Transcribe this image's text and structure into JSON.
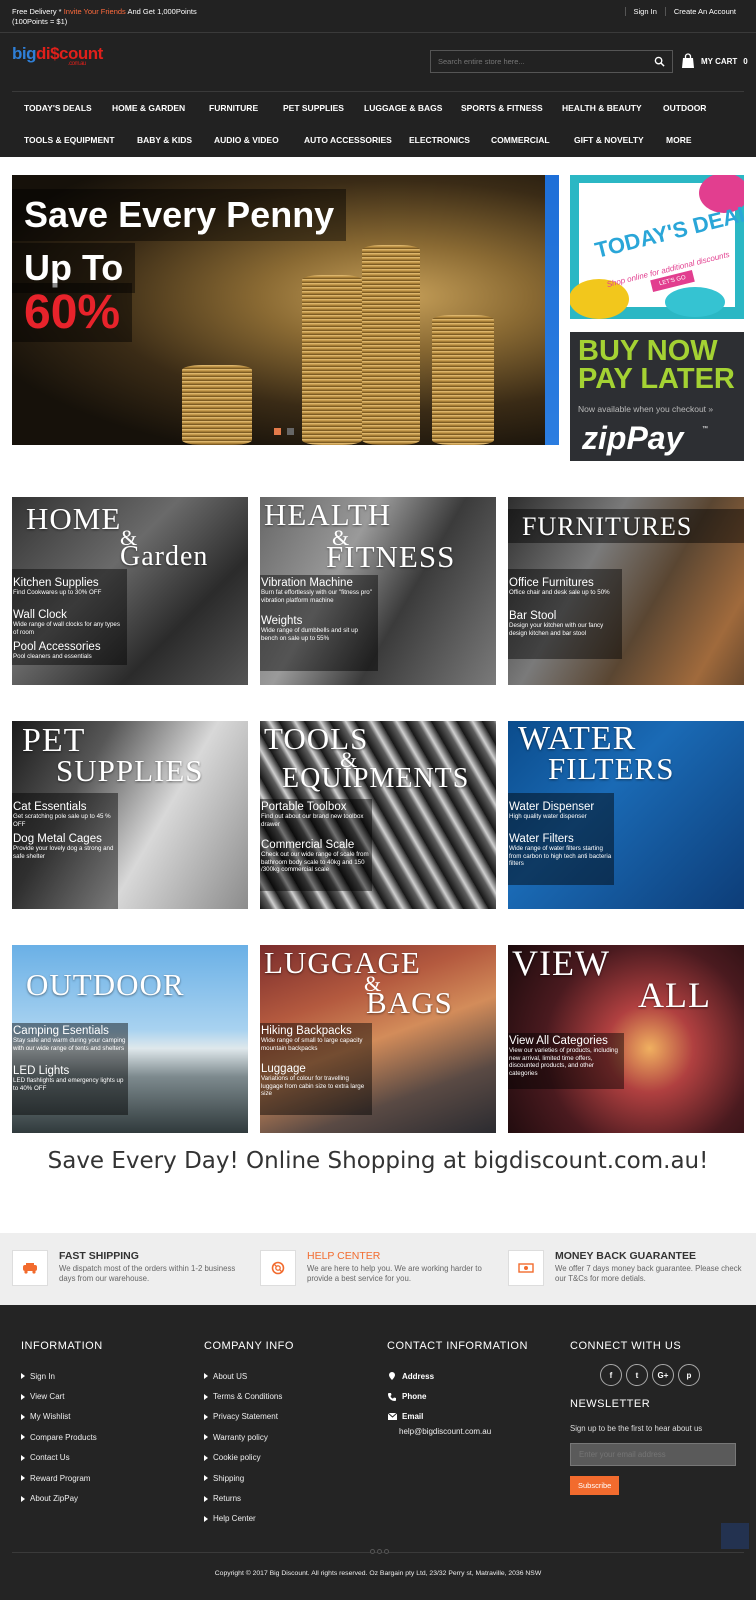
{
  "topbar": {
    "promo_prefix": "Free Delivery * ",
    "promo_link": "Invite Your Friends",
    "promo_suffix": " And Get 1,000Points",
    "promo_line2": "(100Points = $1)",
    "sign_in": "Sign In",
    "create_account": "Create An Account"
  },
  "logo": {
    "part1": "big",
    "part2": "di$count",
    "sub": ".com.au"
  },
  "search": {
    "placeholder": "Search entire store here..."
  },
  "cart": {
    "label": "MY CART",
    "count": "0"
  },
  "nav": {
    "row1": [
      "TODAY'S DEALS",
      "HOME & GARDEN",
      "FURNITURE",
      "PET SUPPLIES",
      "LUGGAGE & BAGS",
      "SPORTS & FITNESS",
      "HEALTH & BEAUTY",
      "OUTDOOR"
    ],
    "row2": [
      "TOOLS & EQUIPMENT",
      "BABY & KIDS",
      "AUDIO & VIDEO",
      "AUTO ACCESSORIES",
      "ELECTRONICS",
      "COMMERCIAL",
      "GIFT & NOVELTY",
      "MORE"
    ]
  },
  "hero": {
    "line1": "Save Every Penny",
    "line2": "Up To",
    "line3": "60%",
    "slides": 2,
    "active_slide": 1
  },
  "promo_deals": {
    "title": "TODAY'S DEALS",
    "sub": "Shop online for additional discounts",
    "button": "LET'S GO"
  },
  "promo_zip": {
    "line1": "BUY NOW",
    "line2": "PAY LATER",
    "sub": "Now available when you checkout »",
    "logo": "zipPay",
    "tm": "™"
  },
  "tiles": {
    "home": {
      "big1": "HOME",
      "amp": "&",
      "big2": "Garden",
      "items": [
        {
          "h": "Kitchen Supplies",
          "d": "Find Cookwares up to 30% OFF"
        },
        {
          "h": "Wall Clock",
          "d": "Wide range of wall clocks for any types of room"
        },
        {
          "h": "Pool Accessories",
          "d": "Pool cleaners and essentials"
        }
      ]
    },
    "health": {
      "big1": "HEALTH",
      "amp": "&",
      "big2": "FITNESS",
      "items": [
        {
          "h": "Vibration Machine",
          "d": "Burn fat effortlessly with our \"fitness pro\" vibration platform machine"
        },
        {
          "h": "Weights",
          "d": "Wide range of dumbbells and sit up bench on sale up to 55%"
        }
      ]
    },
    "furniture": {
      "big1": "FURNITURES",
      "items": [
        {
          "h": "Office Furnitures",
          "d": "Office chair and desk sale up to 50%"
        },
        {
          "h": "Bar Stool",
          "d": "Design your kitchen with our fancy design kitchen and bar stool"
        }
      ]
    },
    "pet": {
      "big1": "PET",
      "big2": "SUPPLIES",
      "items": [
        {
          "h": "Cat Essentials",
          "d": "Get scratching pole sale up to 45 % OFF"
        },
        {
          "h": "Dog Metal Cages",
          "d": "Provide your lovely dog a strong and safe shelter"
        }
      ]
    },
    "tools": {
      "big1": "TOOLS",
      "amp": "&",
      "big2": "EQUIPMENTS",
      "items": [
        {
          "h": "Portable Toolbox",
          "d": "Find out about our brand new toolbox drawer"
        },
        {
          "h": "Commercial Scale",
          "d": "Check out our wide range of scale from bathroom body scale to 40kg and 150 /300kg commercial scale"
        }
      ]
    },
    "water": {
      "big1": "WATER",
      "big2": "FILTERS",
      "items": [
        {
          "h": "Water Dispenser",
          "d": "High quality water dispenser"
        },
        {
          "h": "Water Filters",
          "d": "Wide range of water filters starting from carbon to high tech anti bacteria filters"
        }
      ]
    },
    "outdoor": {
      "big1": "OUTDOOR",
      "items": [
        {
          "h": "Camping Esentials",
          "d": "Stay safe and warm during your camping with our wide range of tents and shelters"
        },
        {
          "h": "LED Lights",
          "d": "LED flashlights and emergency lights up to 40% OFF"
        }
      ]
    },
    "luggage": {
      "big1": "LUGGAGE",
      "amp": "&",
      "big2": "BAGS",
      "items": [
        {
          "h": "Hiking Backpacks",
          "d": "Wide range of small to large capacity mountain backpacks"
        },
        {
          "h": "Luggage",
          "d": "Variations of colour for travelling luggage from cabin size to extra large size"
        }
      ]
    },
    "viewall": {
      "big1": "VIEW",
      "big2": "ALL",
      "items": [
        {
          "h": "View All Categories",
          "d": "View our varieties of products, including new arrival, limited time offers, discounted products, and other categories"
        }
      ]
    }
  },
  "tagline": "Save Every Day! Online Shopping at bigdiscount.com.au!",
  "features": [
    {
      "title": "FAST SHIPPING",
      "desc": "We dispatch most of the orders within 1-2 business days from our warehouse."
    },
    {
      "title": "HELP CENTER",
      "desc": "We are here to help you. We are working harder to provide a best service for you."
    },
    {
      "title": "MONEY BACK GUARANTEE",
      "desc": "We offer 7 days money back guarantee. Please check our T&Cs for more detials."
    }
  ],
  "footer": {
    "info_title": "INFORMATION",
    "info_links": [
      "Sign In",
      "View Cart",
      "My Wishlist",
      "Compare Products",
      "Contact Us",
      "Reward Program",
      "About ZipPay"
    ],
    "company_title": "COMPANY INFO",
    "company_links": [
      "About US",
      "Terms & Conditions",
      "Privacy Statement",
      "Warranty policy",
      "Cookie policy",
      "Shipping",
      "Returns",
      "Help Center"
    ],
    "contact_title": "CONTACT INFORMATION",
    "contact_address": "Address",
    "contact_phone": "Phone",
    "contact_email_label": "Email",
    "contact_email": "help@bigdiscount.com.au",
    "connect_title": "CONNECT WITH US",
    "socials": [
      "f",
      "t",
      "G+",
      "p"
    ],
    "newsletter_title": "NEWSLETTER",
    "newsletter_desc": "Sign up to be the first to hear about us",
    "newsletter_placeholder": "Enter your email address",
    "subscribe": "Subscribe",
    "copyright": "Copyright © 2017 Big Discount. All rights reserved. Oz Bargain pty Ltd, 23/32 Perry st, Matraville, 2036 NSW"
  },
  "colors": {
    "header_bg": "#222222",
    "accent": "#f26b2e",
    "zip_green": "#a4d233"
  }
}
